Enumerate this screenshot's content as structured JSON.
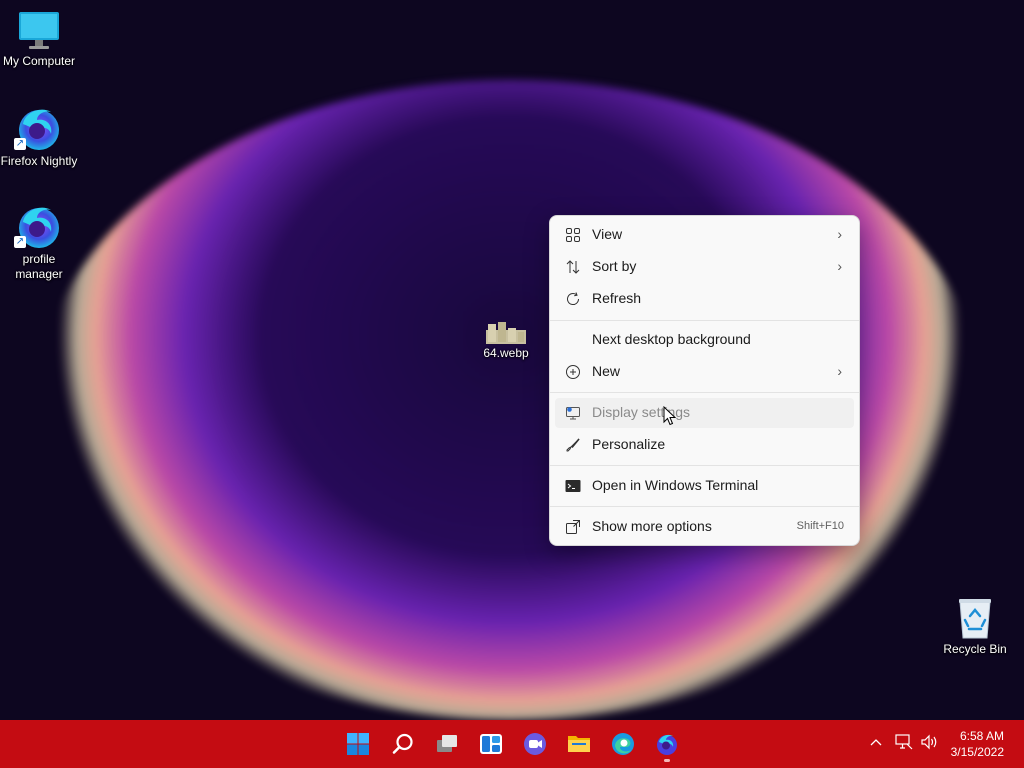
{
  "desktop": {
    "icons": [
      {
        "label": "My Computer",
        "icon": "monitor-icon"
      },
      {
        "label": "Firefox Nightly",
        "icon": "firefox-nightly-icon"
      },
      {
        "label": "profile manager",
        "icon": "firefox-nightly-icon"
      },
      {
        "label": "64.webp",
        "icon": "image-file-icon"
      },
      {
        "label": "Recycle Bin",
        "icon": "recycle-bin-icon"
      }
    ]
  },
  "context_menu": {
    "items": [
      {
        "label": "View",
        "icon": "grid-icon",
        "submenu": true
      },
      {
        "label": "Sort by",
        "icon": "sort-icon",
        "submenu": true
      },
      {
        "label": "Refresh",
        "icon": "refresh-icon"
      },
      {
        "label": "Next desktop background"
      },
      {
        "label": "New",
        "icon": "plus-circle-icon",
        "submenu": true
      },
      {
        "label": "Display settings",
        "icon": "display-icon",
        "state": "hover"
      },
      {
        "label": "Personalize",
        "icon": "brush-icon"
      },
      {
        "label": "Open in Windows Terminal",
        "icon": "terminal-icon"
      },
      {
        "label": "Show more options",
        "icon": "more-options-icon",
        "shortcut": "Shift+F10"
      }
    ]
  },
  "taskbar": {
    "color": "#c40c12",
    "apps": [
      {
        "name": "start",
        "icon": "windows-logo-icon"
      },
      {
        "name": "search",
        "icon": "search-icon"
      },
      {
        "name": "task-view",
        "icon": "task-view-icon"
      },
      {
        "name": "widgets",
        "icon": "widgets-icon"
      },
      {
        "name": "chat",
        "icon": "teams-chat-icon"
      },
      {
        "name": "file-explorer",
        "icon": "folder-icon"
      },
      {
        "name": "edge",
        "icon": "edge-icon"
      },
      {
        "name": "firefox-nightly",
        "icon": "firefox-nightly-icon",
        "running": true
      }
    ],
    "tray": [
      "chevron-up-icon",
      "network-icon",
      "volume-icon"
    ],
    "clock": {
      "time": "6:58 AM",
      "date": "3/15/2022"
    }
  }
}
